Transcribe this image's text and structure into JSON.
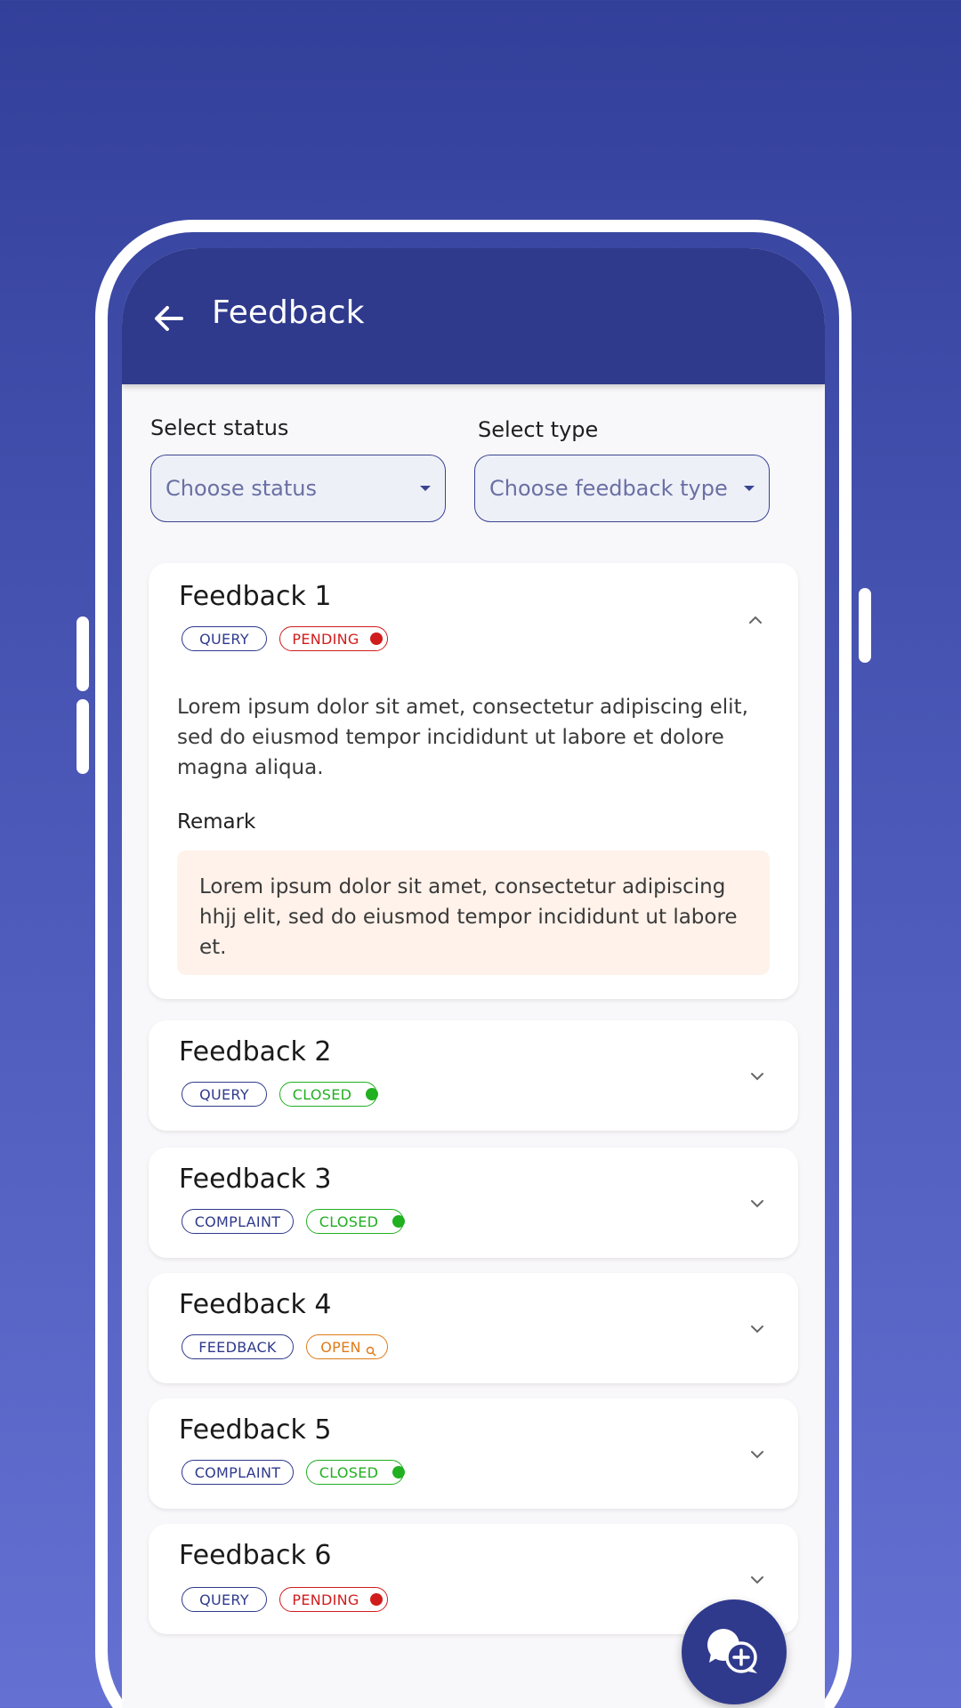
{
  "header": {
    "title": "Feedback"
  },
  "filters": {
    "status_label": "Select status",
    "status_placeholder": "Choose status",
    "type_label": "Select type",
    "type_placeholder": "Choose feedback type"
  },
  "feedbacks": [
    {
      "title": "Feedback 1",
      "type": "QUERY",
      "status": "PENDING",
      "expanded": true,
      "description": "Lorem ipsum dolor sit amet, consectetur adipiscing elit, sed do eiusmod tempor incididunt ut labore et dolore magna aliqua.",
      "remark_label": "Remark",
      "remark": "Lorem ipsum dolor sit amet, consectetur adipiscing hhjj elit, sed do eiusmod tempor incididunt ut labore et."
    },
    {
      "title": "Feedback 2",
      "type": "QUERY",
      "status": "CLOSED",
      "expanded": false
    },
    {
      "title": "Feedback 3",
      "type": "COMPLAINT",
      "status": "CLOSED",
      "expanded": false
    },
    {
      "title": "Feedback 4",
      "type": "FEEDBACK",
      "status": "OPEN",
      "expanded": false
    },
    {
      "title": "Feedback 5",
      "type": "COMPLAINT",
      "status": "CLOSED",
      "expanded": false
    },
    {
      "title": "Feedback 6",
      "type": "QUERY",
      "status": "PENDING",
      "expanded": false
    }
  ],
  "colors": {
    "background_top": "#33409a",
    "background_bottom": "#6571d2",
    "header": "#2f3a8c",
    "pending": "#d11c1c",
    "closed": "#20b020",
    "open": "#e07a1a",
    "remark_bg": "#fff2ea"
  },
  "icons": {
    "back": "arrow-left-icon",
    "collapse": "chevron-up-icon",
    "expand": "chevron-down-icon",
    "fab": "chat-add-icon"
  }
}
